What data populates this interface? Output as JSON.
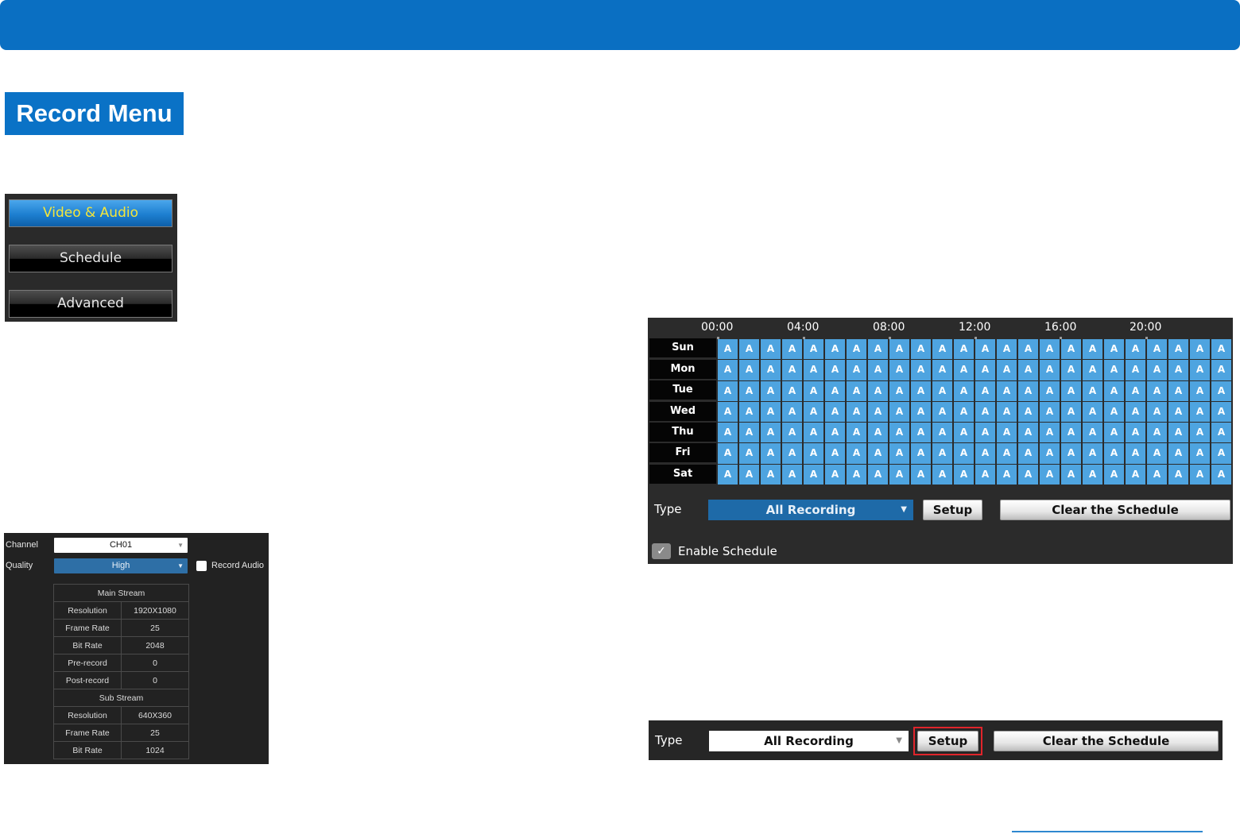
{
  "title": "Record Menu",
  "menu": {
    "items": [
      {
        "label": "Video & Audio",
        "active": true
      },
      {
        "label": "Schedule",
        "active": false
      },
      {
        "label": "Advanced",
        "active": false
      }
    ]
  },
  "stream": {
    "channel_label": "Channel",
    "channel_value": "CH01",
    "quality_label": "Quality",
    "quality_value": "High",
    "record_audio_label": "Record Audio",
    "main_header": "Main Stream",
    "main_rows": [
      {
        "k": "Resolution",
        "v": "1920X1080"
      },
      {
        "k": "Frame Rate",
        "v": "25"
      },
      {
        "k": "Bit Rate",
        "v": "2048"
      },
      {
        "k": "Pre-record",
        "v": "0"
      },
      {
        "k": "Post-record",
        "v": "0"
      }
    ],
    "sub_header": "Sub Stream",
    "sub_rows": [
      {
        "k": "Resolution",
        "v": "640X360"
      },
      {
        "k": "Frame Rate",
        "v": "25"
      },
      {
        "k": "Bit Rate",
        "v": "1024"
      }
    ]
  },
  "schedule": {
    "times": [
      "00:00",
      "04:00",
      "08:00",
      "12:00",
      "16:00",
      "20:00"
    ],
    "days": [
      "Sun",
      "Mon",
      "Tue",
      "Wed",
      "Thu",
      "Fri",
      "Sat"
    ],
    "cell_value": "A",
    "hours_per_day": 24,
    "type_label": "Type",
    "type_value": "All Recording",
    "setup_label": "Setup",
    "clear_label": "Clear the Schedule",
    "enable_label": "Enable Schedule",
    "enable_checked": true
  },
  "type_bar": {
    "type_label": "Type",
    "type_value": "All Recording",
    "setup_label": "Setup",
    "clear_label": "Clear the Schedule"
  },
  "colors": {
    "brand_blue": "#0a6fc2",
    "cell_blue": "#4ea4e0",
    "active_text": "#f5e63a",
    "highlight_red": "#e0242b"
  }
}
